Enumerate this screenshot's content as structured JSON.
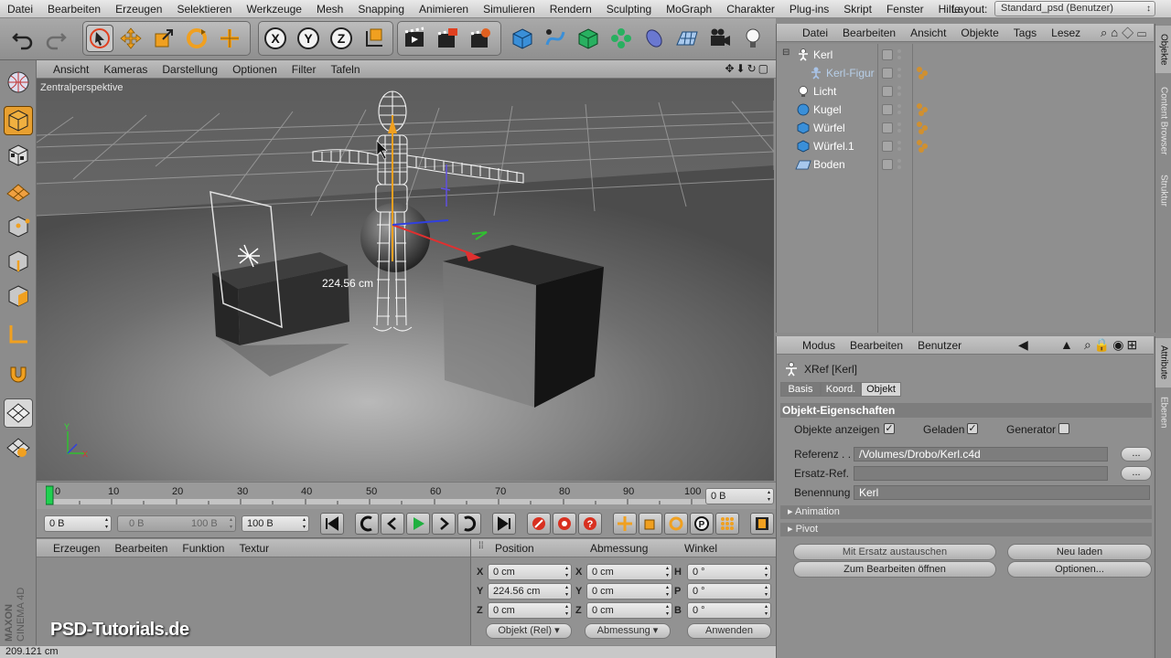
{
  "menubar": {
    "items": [
      "Datei",
      "Bearbeiten",
      "Erzeugen",
      "Selektieren",
      "Werkzeuge",
      "Mesh",
      "Snapping",
      "Animieren",
      "Simulieren",
      "Rendern",
      "Sculpting",
      "MoGraph",
      "Charakter",
      "Plug-ins",
      "Skript",
      "Fenster",
      "Hilfe"
    ],
    "layout_label": "Layout:",
    "layout_value": "Standard_psd (Benutzer)"
  },
  "toolbar": {
    "axis_x": "X",
    "axis_y": "Y",
    "axis_z": "Z"
  },
  "viewport": {
    "menu": [
      "Ansicht",
      "Kameras",
      "Darstellung",
      "Optionen",
      "Filter",
      "Tafeln"
    ],
    "label": "Zentralperspektive",
    "dimension_readout": "224.56 cm"
  },
  "timeline": {
    "ticks": [
      "0",
      "10",
      "20",
      "30",
      "40",
      "50",
      "60",
      "70",
      "80",
      "90",
      "100"
    ],
    "current_frame": "0 B"
  },
  "transport": {
    "start": "0 B",
    "range_start": "0 B",
    "range_end": "100 B",
    "end": "100 B"
  },
  "material_panel": {
    "menu": [
      "Erzeugen",
      "Bearbeiten",
      "Funktion",
      "Textur"
    ]
  },
  "coords": {
    "headers": [
      "Position",
      "Abmessung",
      "Winkel"
    ],
    "rows": [
      {
        "pos_axis": "X",
        "pos": "0 cm",
        "size_axis": "X",
        "size": "0 cm",
        "rot_axis": "H",
        "rot": "0 °"
      },
      {
        "pos_axis": "Y",
        "pos": "224.56 cm",
        "size_axis": "Y",
        "size": "0 cm",
        "rot_axis": "P",
        "rot": "0 °"
      },
      {
        "pos_axis": "Z",
        "pos": "0 cm",
        "size_axis": "Z",
        "size": "0 cm",
        "rot_axis": "B",
        "rot": "0 °"
      }
    ],
    "mode_select": "Objekt (Rel)",
    "size_select": "Abmessung",
    "apply_label": "Anwenden"
  },
  "status": {
    "text": "209.121 cm"
  },
  "watermark": {
    "text": "PSD-Tutorials.de",
    "brand_maxon": "MAXON",
    "brand_c4d": "CINEMA 4D"
  },
  "objects_panel": {
    "menu": [
      "Datei",
      "Bearbeiten",
      "Ansicht",
      "Objekte",
      "Tags",
      "Lesez"
    ],
    "items": [
      {
        "name": "Kerl",
        "icon": "xref-figure-icon",
        "indent": 0
      },
      {
        "name": "Kerl-Figur",
        "icon": "figure-icon",
        "indent": 1
      },
      {
        "name": "Licht",
        "icon": "light-icon",
        "indent": 0
      },
      {
        "name": "Kugel",
        "icon": "sphere-icon",
        "indent": 0
      },
      {
        "name": "Würfel",
        "icon": "cube-icon",
        "indent": 0
      },
      {
        "name": "Würfel.1",
        "icon": "cube-icon",
        "indent": 0
      },
      {
        "name": "Boden",
        "icon": "floor-icon",
        "indent": 0
      }
    ]
  },
  "side_tabs": {
    "top": [
      "Objekte",
      "Content Browser",
      "Struktur"
    ],
    "bottom": [
      "Attribute",
      "Ebenen"
    ]
  },
  "attributes": {
    "menu": [
      "Modus",
      "Bearbeiten",
      "Benutzer"
    ],
    "object_title": "XRef [Kerl]",
    "tabs": [
      "Basis",
      "Koord.",
      "Objekt"
    ],
    "section": "Objekt-Eigenschaften",
    "show_objects_label": "Objekte anzeigen",
    "loaded_label": "Geladen",
    "generator_label": "Generator",
    "reference_label": "Referenz . . .",
    "reference_value": "/Volumes/Drobo/Kerl.c4d",
    "replacement_label": "Ersatz-Ref.",
    "replacement_value": "",
    "naming_label": "Benennung",
    "naming_value": "Kerl",
    "dots": "...",
    "animation_label": "Animation",
    "pivot_label": "Pivot",
    "btn_replace": "Mit Ersatz austauschen",
    "btn_reload": "Neu laden",
    "btn_edit": "Zum Bearbeiten öffnen",
    "btn_options": "Optionen..."
  },
  "colors": {
    "accent_orange": "#f0a020",
    "accent_blue": "#3a8fd8",
    "viewport_bg": "#606060"
  }
}
